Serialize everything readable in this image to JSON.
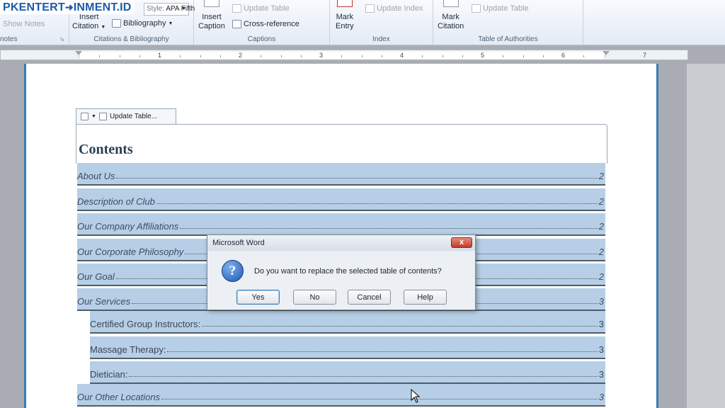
{
  "watermark": {
    "text": "PKENTERT",
    "icon": "arrow-icon",
    "text2": "INMENT.ID"
  },
  "ribbon": {
    "footnotes": {
      "show_notes": "Show Notes",
      "label": "notes"
    },
    "citations": {
      "insert_citation": [
        "Insert",
        "Citation"
      ],
      "style_value": "APA Fifth",
      "bibliography": "Bibliography",
      "label": "Citations & Bibliography"
    },
    "captions": {
      "insert_caption": [
        "Insert",
        "Caption"
      ],
      "update_table": "Update Table",
      "cross_reference": "Cross-reference",
      "label": "Captions"
    },
    "index": {
      "mark_entry": [
        "Mark",
        "Entry"
      ],
      "update_index": "Update Index",
      "label": "Index"
    },
    "authorities": {
      "mark_citation": [
        "Mark",
        "Citation"
      ],
      "update_table": "Update Table",
      "label": "Table of Authorities"
    }
  },
  "ruler": {
    "numbers": [
      "1",
      "2",
      "3",
      "4",
      "5",
      "6",
      "7"
    ]
  },
  "toc": {
    "tab_label": "Update Table...",
    "title": "Contents",
    "entries": [
      {
        "text": "About Us",
        "page": "2"
      },
      {
        "text": "Description of Club",
        "page": "2"
      },
      {
        "text": "Our Company Affiliations",
        "page": "2"
      },
      {
        "text": "Our Corporate Philosophy",
        "page": "2"
      },
      {
        "text": "Our Goal",
        "page": "2"
      },
      {
        "text": "Our Services",
        "page": "3"
      },
      {
        "text": "Certified Group Instructors:",
        "page": "3"
      },
      {
        "text": "Massage Therapy:",
        "page": "3"
      },
      {
        "text": "Dietician:",
        "page": "3"
      },
      {
        "text": "Our Other Locations",
        "page": "3"
      }
    ]
  },
  "dialog": {
    "title": "Microsoft Word",
    "close": "x",
    "icon": "question-icon",
    "icon_glyph": "?",
    "message": "Do you want to replace the selected table of contents?",
    "buttons": {
      "yes": "Yes",
      "no": "No",
      "cancel": "Cancel",
      "help": "Help"
    }
  },
  "colors": {
    "toc_highlight": "#b6cfe6",
    "page_border": "#3a7ab5",
    "close_button": "#c13b27"
  }
}
